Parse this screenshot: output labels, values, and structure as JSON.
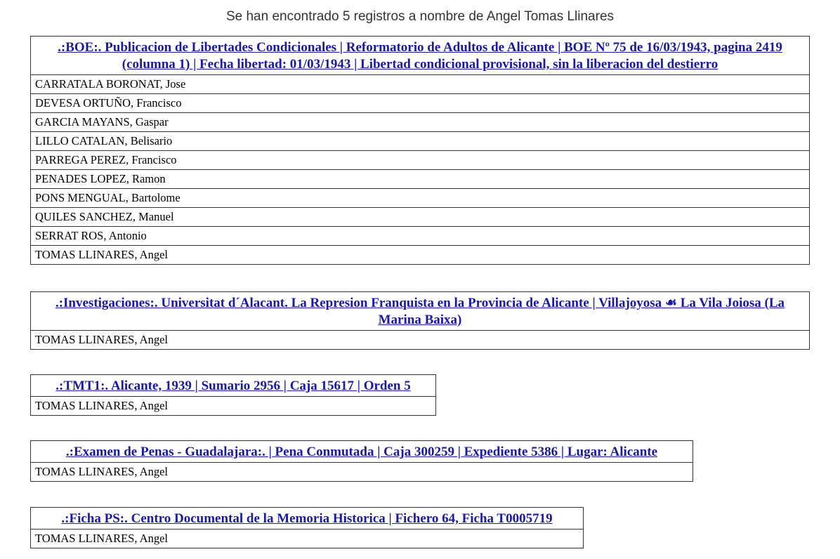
{
  "summary": "Se han encontrado 5 registros a nombre de Angel Tomas Llinares",
  "records": [
    {
      "title": ".:BOE:. Publicacion de Libertades Condicionales | Reformatorio de Adultos de Alicante | BOE Nº 75 de 16/03/1943, pagina 2419 (columna 1) | Fecha libertad: 01/03/1943 | Libertad condicional provisional, sin la liberacion del destierro",
      "names": [
        "CARRATALA BORONAT, Jose",
        "DEVESA ORTUÑO, Francisco",
        "GARCIA MAYANS, Gaspar",
        "LILLO CATALAN, Belisario",
        "PARREGA PEREZ, Francisco",
        "PENADES LOPEZ, Ramon",
        "PONS MENGUAL, Bartolome",
        "QUILES SANCHEZ, Manuel",
        "SERRAT ROS, Antonio",
        "TOMAS LLINARES, Angel"
      ]
    },
    {
      "title": ".:Investigaciones:. Universitat d´Alacant. La Represion Franquista en la Provincia de Alicante | Villajoyosa ☙ La Vila Joiosa (La Marina Baixa)",
      "names": [
        "TOMAS LLINARES, Angel"
      ]
    },
    {
      "title": ".:TMT1:. Alicante, 1939 | Sumario 2956 | Caja 15617 | Orden 5",
      "names": [
        "TOMAS LLINARES, Angel"
      ]
    },
    {
      "title": ".:Examen de Penas - Guadalajara:. | Pena Conmutada | Caja 300259 | Expediente 5386 | Lugar: Alicante",
      "names": [
        "TOMAS LLINARES, Angel"
      ]
    },
    {
      "title": ".:Ficha PS:. Centro Documental de la Memoria Historica | Fichero 64, Ficha T0005719",
      "names": [
        "TOMAS LLINARES, Angel"
      ]
    }
  ]
}
